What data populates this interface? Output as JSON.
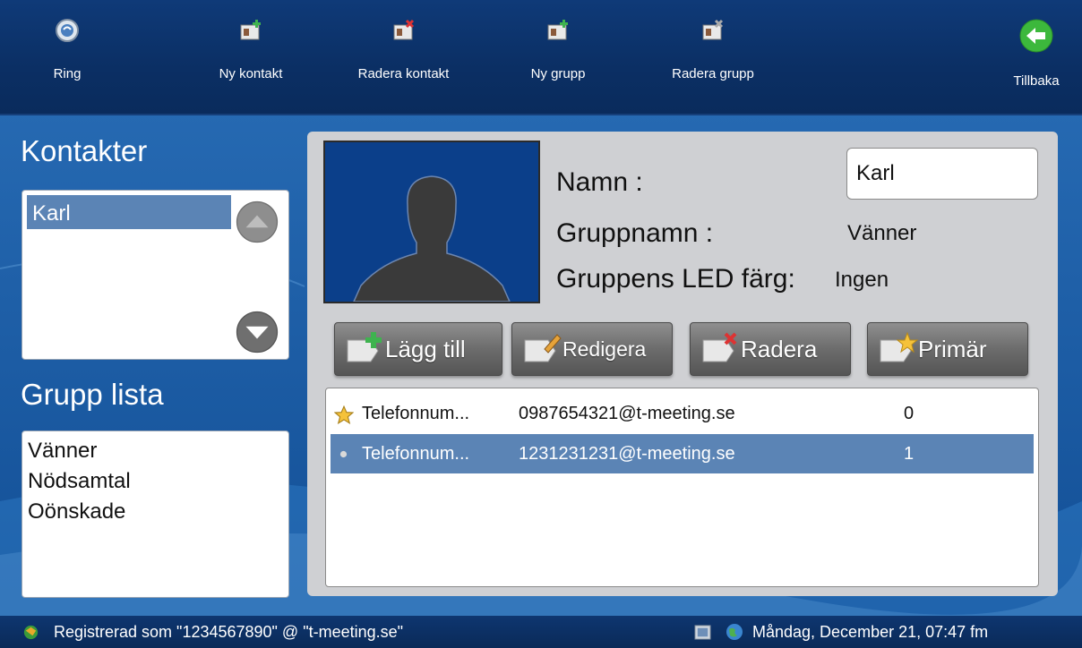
{
  "toolbar": {
    "items": [
      {
        "label": "Ring",
        "icon": "call-icon"
      },
      {
        "label": "Ny kontakt",
        "icon": "new-contact-icon"
      },
      {
        "label": "Radera kontakt",
        "icon": "delete-contact-icon"
      },
      {
        "label": "Ny grupp",
        "icon": "new-group-icon"
      },
      {
        "label": "Radera grupp",
        "icon": "delete-group-icon"
      }
    ],
    "back_label": "Tillbaka",
    "back_icon": "back-arrow-icon"
  },
  "contacts": {
    "heading": "Kontakter",
    "items": [
      "Karl"
    ]
  },
  "groups": {
    "heading": "Grupp lista",
    "items": [
      "Vänner",
      "Nödsamtal",
      "Oönskade"
    ]
  },
  "detail": {
    "name_label": "Namn :",
    "name_value": "Karl",
    "group_label": "Gruppnamn :",
    "group_value": "Vänner",
    "led_label": "Gruppens LED färg:",
    "led_value": "Ingen"
  },
  "actions": {
    "add": "Lägg till",
    "edit": "Redigera",
    "delete": "Radera",
    "primary": "Primär"
  },
  "numbers": [
    {
      "type": "Telefonnum...",
      "address": "0987654321@t-meeting.se",
      "index": "0",
      "primary": true
    },
    {
      "type": "Telefonnum...",
      "address": "1231231231@t-meeting.se",
      "index": "1",
      "primary": false
    }
  ],
  "status": {
    "registration": "Registrerad som \"1234567890\" @ \"t-meeting.se\"",
    "datetime": "Måndag, December 21, 07:47 fm"
  },
  "colors": {
    "toolbar_bg": "#0b2f64",
    "background": "#1b5fa8",
    "selection": "#5b84b5",
    "back_button": "#3cb83c",
    "photo_bg": "#0b3f8a"
  }
}
